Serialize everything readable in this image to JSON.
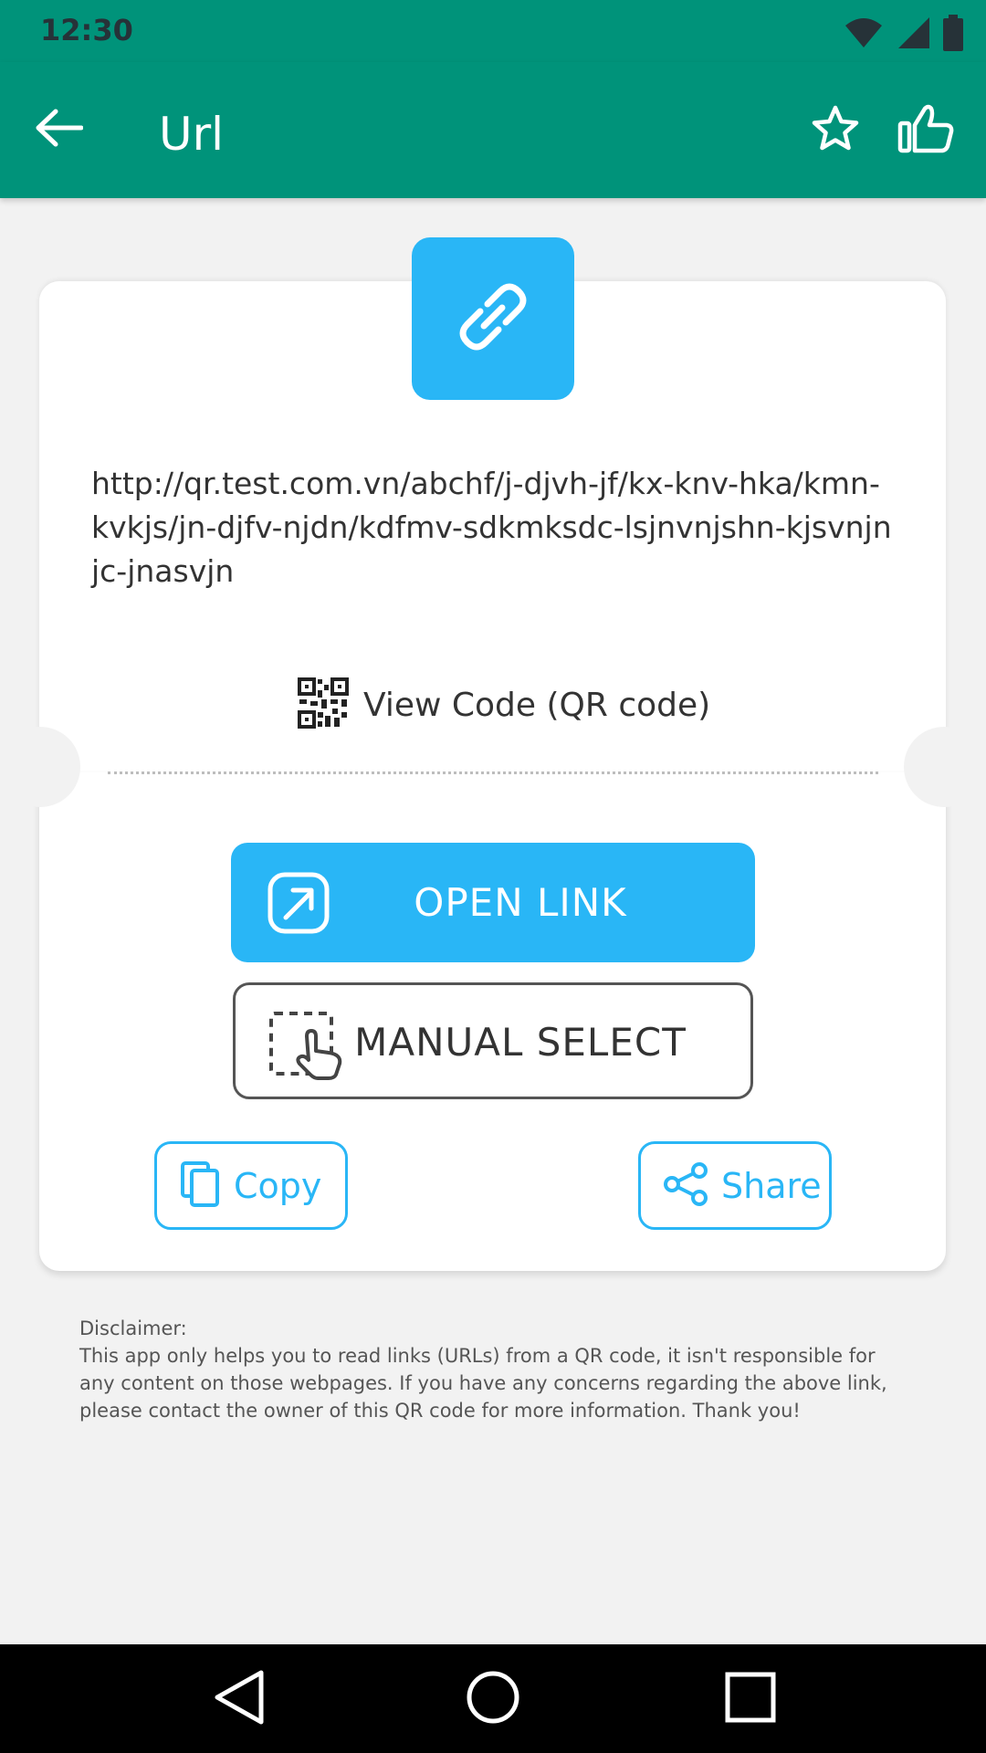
{
  "status_bar": {
    "time": "12:30",
    "icons": [
      "wifi-icon",
      "signal-icon",
      "battery-icon"
    ]
  },
  "app_bar": {
    "title": "Url",
    "back_icon": "arrow-left-icon",
    "favorite_icon": "star-icon",
    "like_icon": "thumbs-up-icon"
  },
  "card": {
    "type_icon": "link-icon",
    "url": "http://qr.test.com.vn/abchf/j-djvh-jf/kx-knv-hka/kmn-kvkjs/jn-djfv-njdn/kdfmv-sdkmksdc-lsjnvnjshn-kjsvnjnjc-jnasvjn",
    "view_code_label": "View Code (QR code)",
    "open_link_label": "OPEN LINK",
    "manual_select_label": "MANUAL SELECT",
    "copy_label": "Copy",
    "share_label": "Share"
  },
  "disclaimer": {
    "heading": "Disclaimer:",
    "body": "This app only helps you to read links (URLs) from a QR code, it isn't responsible for any content on those webpages. If you have any concerns regarding the above link, please contact the owner of this QR code for more information. Thank you!"
  },
  "colors": {
    "primary": "#00937a",
    "accent": "#29b6f6",
    "background": "#f2f2f2"
  }
}
